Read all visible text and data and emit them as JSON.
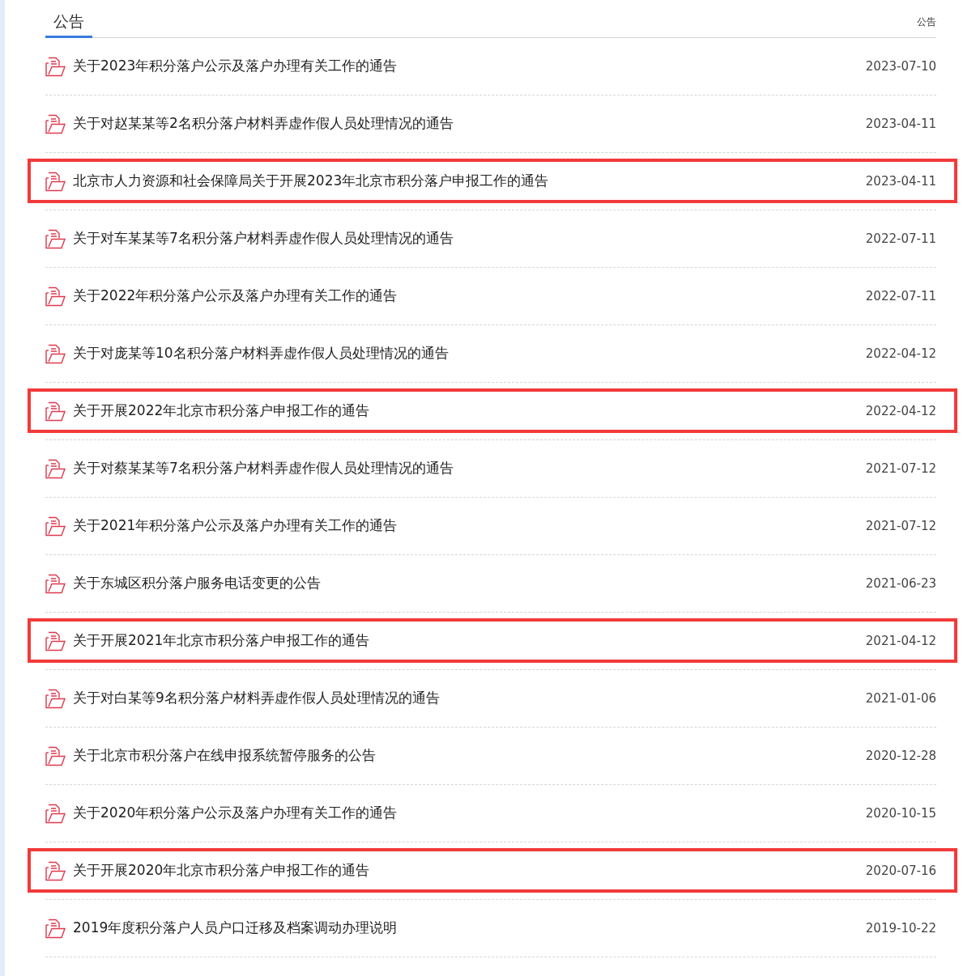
{
  "header": {
    "tab": "公告",
    "link": "公告"
  },
  "notices": [
    {
      "title": "关于2023年积分落户公示及落户办理有关工作的通告",
      "date": "2023-07-10",
      "highlighted": false
    },
    {
      "title": "关于对赵某某等2名积分落户材料弄虚作假人员处理情况的通告",
      "date": "2023-04-11",
      "highlighted": false
    },
    {
      "title": "北京市人力资源和社会保障局关于开展2023年北京市积分落户申报工作的通告",
      "date": "2023-04-11",
      "highlighted": true
    },
    {
      "title": "关于对车某某等7名积分落户材料弄虚作假人员处理情况的通告",
      "date": "2022-07-11",
      "highlighted": false
    },
    {
      "title": "关于2022年积分落户公示及落户办理有关工作的通告",
      "date": "2022-07-11",
      "highlighted": false
    },
    {
      "title": "关于对庞某等10名积分落户材料弄虚作假人员处理情况的通告",
      "date": "2022-04-12",
      "highlighted": false
    },
    {
      "title": "关于开展2022年北京市积分落户申报工作的通告",
      "date": "2022-04-12",
      "highlighted": true
    },
    {
      "title": "关于对蔡某某等7名积分落户材料弄虚作假人员处理情况的通告",
      "date": "2021-07-12",
      "highlighted": false
    },
    {
      "title": "关于2021年积分落户公示及落户办理有关工作的通告",
      "date": "2021-07-12",
      "highlighted": false
    },
    {
      "title": "关于东城区积分落户服务电话变更的公告",
      "date": "2021-06-23",
      "highlighted": false
    },
    {
      "title": "关于开展2021年北京市积分落户申报工作的通告",
      "date": "2021-04-12",
      "highlighted": true
    },
    {
      "title": "关于对白某等9名积分落户材料弄虚作假人员处理情况的通告",
      "date": "2021-01-06",
      "highlighted": false
    },
    {
      "title": "关于北京市积分落户在线申报系统暂停服务的公告",
      "date": "2020-12-28",
      "highlighted": false
    },
    {
      "title": "关于2020年积分落户公示及落户办理有关工作的通告",
      "date": "2020-10-15",
      "highlighted": false
    },
    {
      "title": "关于开展2020年北京市积分落户申报工作的通告",
      "date": "2020-07-16",
      "highlighted": true
    },
    {
      "title": "2019年度积分落户人员户口迁移及档案调动办理说明",
      "date": "2019-10-22",
      "highlighted": false
    }
  ]
}
